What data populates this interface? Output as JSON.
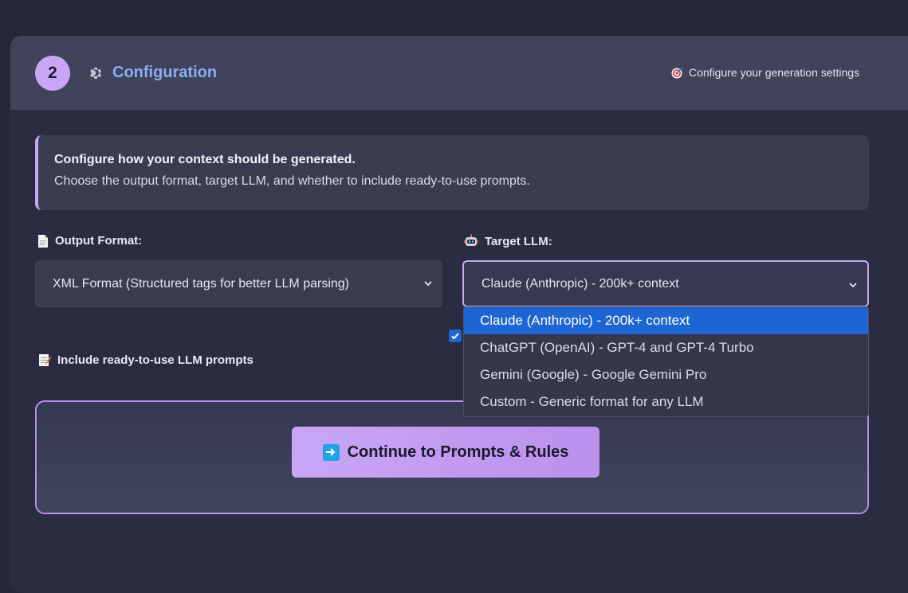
{
  "header": {
    "step_number": "2",
    "title": "Configuration",
    "hint": "Configure your generation settings"
  },
  "info": {
    "title": "Configure how your context should be generated.",
    "text": "Choose the output format, target LLM, and whether to include ready-to-use prompts."
  },
  "output_format": {
    "label": "Output Format:",
    "icon": "document-icon",
    "selected": "XML Format (Structured tags for better LLM parsing)"
  },
  "target_llm": {
    "label": "Target LLM:",
    "icon": "robot-icon",
    "selected": "Claude (Anthropic) - 200k+ context",
    "options": [
      "Claude (Anthropic) - 200k+ context",
      "ChatGPT (OpenAI) - GPT-4 and GPT-4 Turbo",
      "Gemini (Google) - Google Gemini Pro",
      "Custom - Generic format for any LLM"
    ]
  },
  "prompts_option": {
    "label": "Include ready-to-use LLM prompts",
    "icon": "memo-icon",
    "checked": true
  },
  "continue_button": {
    "label": "Continue to Prompts & Rules",
    "icon": "right-arrow-icon"
  },
  "colors": {
    "accent": "#c9a6f5",
    "title_blue": "#8aaef5",
    "selection_blue": "#1e66d4"
  }
}
